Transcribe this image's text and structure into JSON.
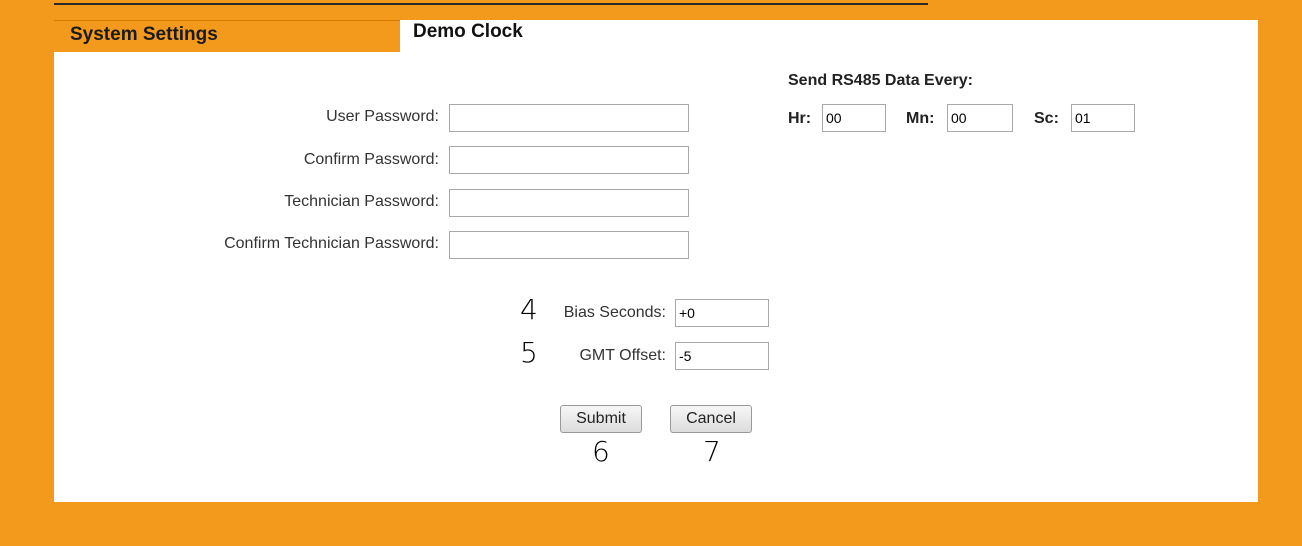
{
  "tabs": {
    "system_settings": "System Settings",
    "demo_clock": "Demo Clock"
  },
  "form": {
    "user_password_label": "User Password:",
    "confirm_password_label": "Confirm Password:",
    "technician_password_label": "Technician Password:",
    "confirm_technician_password_label": "Confirm Technician Password:",
    "user_password": "",
    "confirm_password": "",
    "technician_password": "",
    "confirm_technician_password": ""
  },
  "rs485": {
    "title": "Send RS485 Data Every:",
    "hr_label": "Hr:",
    "hr_value": "00",
    "mn_label": "Mn:",
    "mn_value": "00",
    "sc_label": "Sc:",
    "sc_value": "01"
  },
  "time": {
    "bias_label": "Bias Seconds:",
    "bias_value": "+0",
    "gmt_label": "GMT Offset:",
    "gmt_value": "-5"
  },
  "buttons": {
    "submit": "Submit",
    "cancel": "Cancel"
  },
  "annotations": {
    "n4": "4",
    "n5": "5",
    "n6": "6",
    "n7": "7"
  },
  "colors": {
    "background": "#f39a1c",
    "panel": "#ffffff"
  }
}
